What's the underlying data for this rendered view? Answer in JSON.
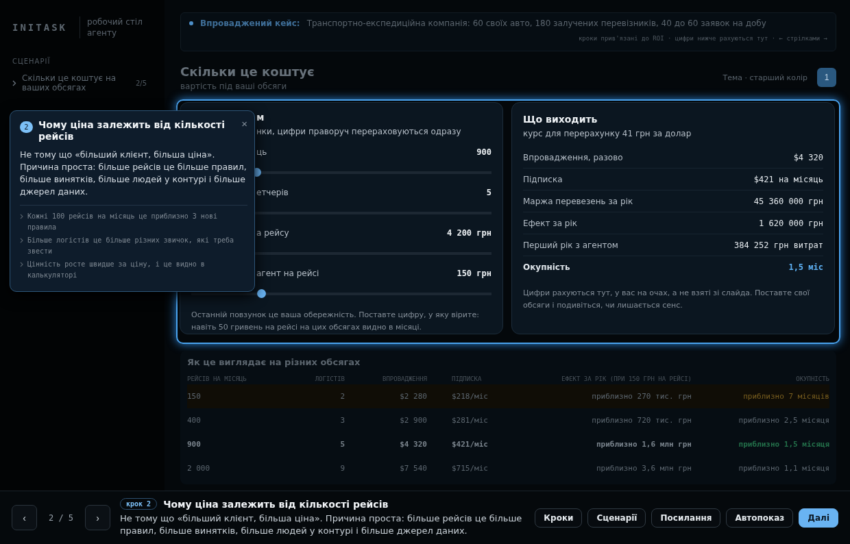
{
  "sidebar": {
    "logo": "INITASK",
    "tagline": [
      "робочий стіл",
      "агенту"
    ],
    "section": "СЦЕНАРІЇ",
    "items": [
      {
        "label": "Скільки це коштує на ваших обсягах",
        "count": "2/5"
      }
    ]
  },
  "banner": {
    "label": "Впроваджений кейс:",
    "text": "Транспортно-експедиційна компанія: 60 своїх авто, 180 залучених перевізників, 40 до 60 заявок на добу",
    "hint": "кроки прив'язані до ROI · цифри нижче рахуються тут · ← стрілками →"
  },
  "header": {
    "title": "Скільки це коштує",
    "subtitle": "вартість під ваші обсяги",
    "theme_label": "Тема · старший колір",
    "theme_button": "1"
  },
  "inputs_card": {
    "title_visible": "м",
    "subtitle_visible": "нки, цифри праворуч перераховуються одразу",
    "sliders": [
      {
        "label_visible": "ць",
        "value": "900",
        "level": 0.216
      },
      {
        "label_visible": "етчерів",
        "value": "5"
      },
      {
        "label_visible": "а рейсу",
        "value": "4 200 грн"
      },
      {
        "label_visible": "агент на рейсі",
        "value": "150 грн",
        "level": 0.232
      }
    ],
    "note": "Останній повзунок це ваша обережність. Поставте цифру, у яку вірите: навіть 50 гривень на рейсі на цих обсягах видно в місяці."
  },
  "results_card": {
    "title": "Що виходить",
    "subtitle": "курс для перерахунку 41 грн за долар",
    "rows": [
      {
        "label": "Впровадження, разово",
        "value": "$4 320",
        "kind": "normal"
      },
      {
        "label": "Підписка",
        "value": "$421 на місяць",
        "kind": "normal"
      },
      {
        "label": "Маржа перевезень за рік",
        "value": "45 360 000 грн",
        "kind": "normal"
      },
      {
        "label": "Ефект за рік",
        "value": "1 620 000 грн",
        "kind": "normal"
      },
      {
        "label": "Перший рік з агентом",
        "value": "384 252 грн витрат",
        "kind": "normal"
      },
      {
        "label": "Окупність",
        "value": "1,5 міс",
        "kind": "total"
      }
    ],
    "note": "Цифри рахуються тут, у вас на очах, а не взяті зі слайда. Поставте свої обсяги і подивіться, чи лишається сенс."
  },
  "table": {
    "title": "Як це виглядає на різних обсягах",
    "columns": [
      "РЕЙСІВ НА МІСЯЦЬ",
      "ЛОГІСТІВ",
      "ВПРОВАДЖЕННЯ",
      "ПІДПИСКА",
      "ЕФЕКТ ЗА РІК (ПРИ 150 ГРН НА РЕЙСІ)",
      "ОКУПНІСТЬ"
    ],
    "rows": [
      {
        "cells": [
          "150",
          "2",
          "$2 280",
          "$218/міс",
          "приблизно 270 тис. грн",
          "приблизно 7 місяців"
        ],
        "kind": "slow",
        "color": "#7a5f1f",
        "selected": false
      },
      {
        "cells": [
          "400",
          "3",
          "$2 900",
          "$281/міс",
          "приблизно 720 тис. грн",
          "приблизно 2,5 місяця"
        ],
        "kind": "normal",
        "color": "#5d6770",
        "selected": false
      },
      {
        "cells": [
          "900",
          "5",
          "$4 320",
          "$421/міс",
          "приблизно 1,6 млн грн",
          "приблизно 1,5 місяця"
        ],
        "kind": "normal",
        "color": "#23704a",
        "selected": true
      },
      {
        "cells": [
          "2 000",
          "9",
          "$7 540",
          "$715/міс",
          "приблизно 3,6 млн грн",
          "приблизно 1,1 місяця"
        ],
        "kind": "normal",
        "color": "#5d6770",
        "selected": false
      }
    ]
  },
  "popover": {
    "step": "2",
    "title": "Чому ціна залежить від кількості рейсів",
    "close": "×",
    "body": "Не тому що «більший клієнт, більша ціна». Причина проста: більше рейсів це більше правил, більше винятків, більше людей у контурі і більше джерел даних.",
    "points": [
      "Кожні 100 рейсів на місяць це приблизно 3 нові правила",
      "Більше логістів це більше різних звичок, які треба звести",
      "Цінність росте швидше за ціну, і це видно в калькуляторі"
    ]
  },
  "tour_bar": {
    "prev": "‹",
    "counter": "2 / 5",
    "next": "›",
    "badge": "крок 2",
    "title": "Чому ціна залежить від кількості рейсів",
    "text": "Не тому що «більший клієнт, більша ціна». Причина проста: більше рейсів це більше правил, більше винятків, більше людей у контурі і більше джерел даних.",
    "buttons": [
      {
        "label": "Кроки",
        "kind": "secondary"
      },
      {
        "label": "Сценарії",
        "kind": "secondary"
      },
      {
        "label": "Посилання",
        "kind": "secondary"
      },
      {
        "label": "Автопоказ",
        "kind": "secondary"
      },
      {
        "label": "Далі",
        "kind": "primary"
      }
    ]
  }
}
